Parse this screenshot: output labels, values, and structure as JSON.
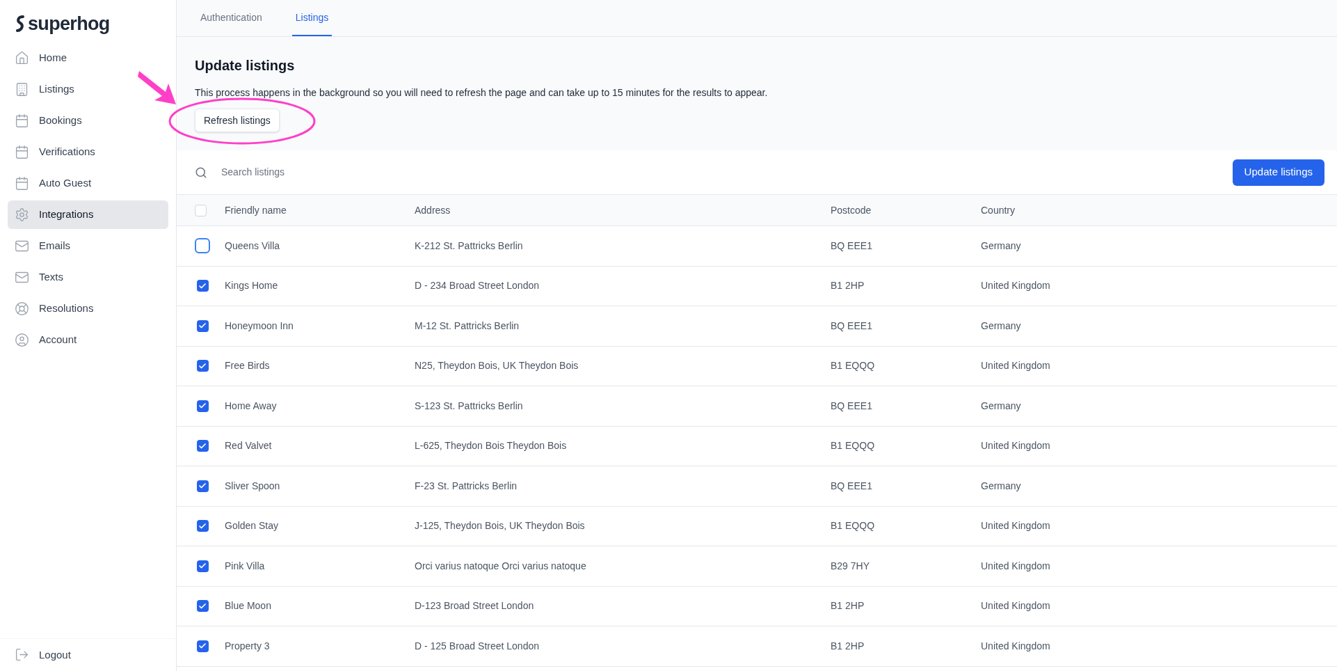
{
  "logo": {
    "text": "superhog"
  },
  "sidebar": {
    "items": [
      {
        "label": "Home",
        "selected": false
      },
      {
        "label": "Listings",
        "selected": false
      },
      {
        "label": "Bookings",
        "selected": false
      },
      {
        "label": "Verifications",
        "selected": false
      },
      {
        "label": "Auto Guest",
        "selected": false
      },
      {
        "label": "Integrations",
        "selected": true
      },
      {
        "label": "Emails",
        "selected": false
      },
      {
        "label": "Texts",
        "selected": false
      },
      {
        "label": "Resolutions",
        "selected": false
      },
      {
        "label": "Account",
        "selected": false
      }
    ],
    "logout": "Logout"
  },
  "tabs": [
    {
      "label": "Authentication",
      "selected": false
    },
    {
      "label": "Listings",
      "selected": true
    }
  ],
  "section": {
    "title": "Update listings",
    "description": "This process happens in the background so you will need to refresh the page and can take up to 15 minutes for the results to appear.",
    "button": "Refresh listings"
  },
  "search": {
    "placeholder": "Search listings"
  },
  "update_button": "Update listings",
  "table": {
    "select_all_checked": false,
    "columns": [
      "Friendly name",
      "Address",
      "Postcode",
      "Country"
    ],
    "rows": [
      {
        "cells": [
          "Queens Villa",
          "K-212 St. Pattricks Berlin",
          "BQ EEE1",
          "Germany"
        ],
        "checked": false
      },
      {
        "cells": [
          "Kings Home",
          "D - 234 Broad Street London",
          "B1 2HP",
          "United Kingdom"
        ],
        "checked": true
      },
      {
        "cells": [
          "Honeymoon Inn",
          "M-12 St. Pattricks Berlin",
          "BQ EEE1",
          "Germany"
        ],
        "checked": true
      },
      {
        "cells": [
          "Free Birds",
          "N25, Theydon Bois, UK Theydon Bois",
          "B1 EQQQ",
          "United Kingdom"
        ],
        "checked": true
      },
      {
        "cells": [
          "Home Away",
          "S-123 St. Pattricks Berlin",
          "BQ EEE1",
          "Germany"
        ],
        "checked": true
      },
      {
        "cells": [
          "Red Valvet",
          "L-625, Theydon Bois Theydon Bois",
          "B1 EQQQ",
          "United Kingdom"
        ],
        "checked": true
      },
      {
        "cells": [
          "Sliver Spoon",
          "F-23 St. Pattricks Berlin",
          "BQ EEE1",
          "Germany"
        ],
        "checked": true
      },
      {
        "cells": [
          "Golden Stay",
          "J-125, Theydon Bois, UK Theydon Bois",
          "B1 EQQQ",
          "United Kingdom"
        ],
        "checked": true
      },
      {
        "cells": [
          "Pink Villa",
          "Orci varius natoque Orci varius natoque",
          "B29 7HY",
          "United Kingdom"
        ],
        "checked": true
      },
      {
        "cells": [
          "Blue Moon",
          "D-123 Broad Street London",
          "B1 2HP",
          "United Kingdom"
        ],
        "checked": true
      },
      {
        "cells": [
          "Property 3",
          "D - 125 Broad Street London",
          "B1 2HP",
          "United Kingdom"
        ],
        "checked": true
      }
    ]
  }
}
